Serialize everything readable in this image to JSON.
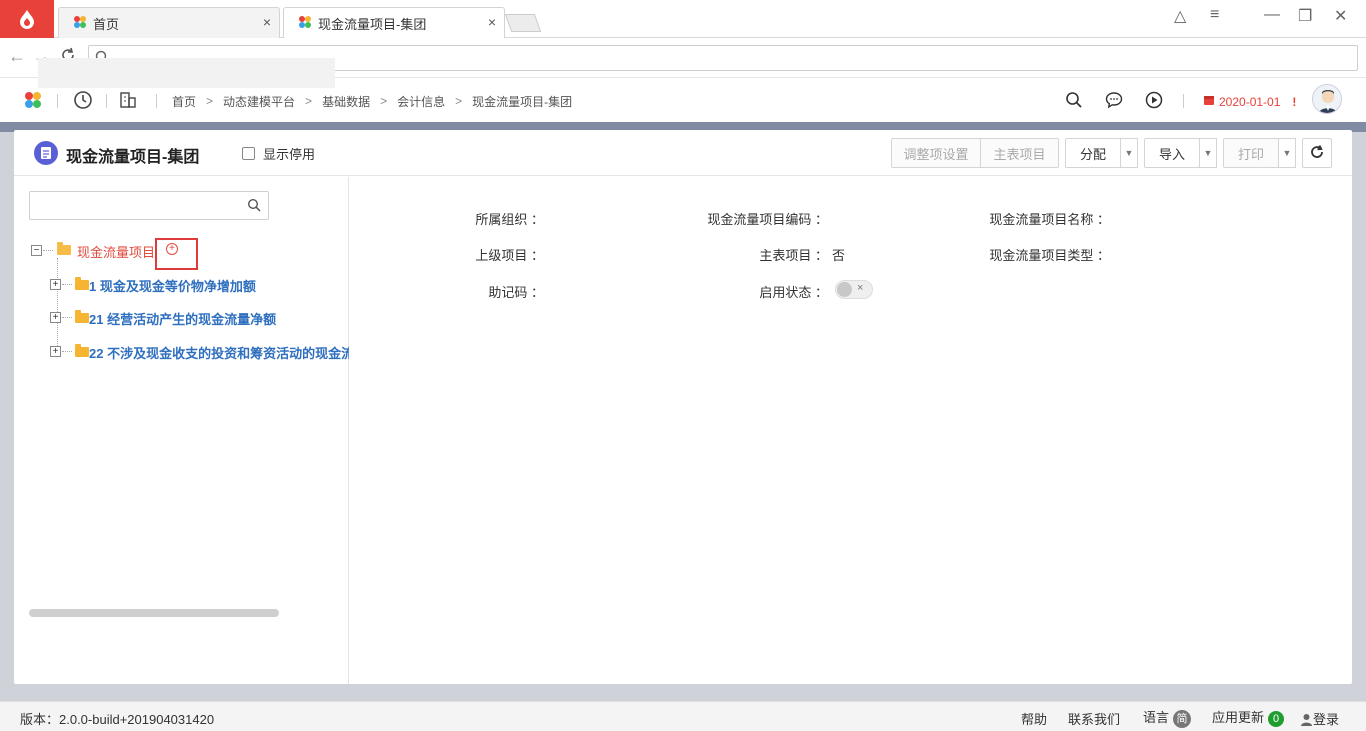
{
  "browser": {
    "tabs": [
      {
        "label": "首页"
      },
      {
        "label": "现金流量项目-集团"
      }
    ],
    "close_glyph": "×",
    "window_controls": [
      "△",
      "≡",
      "—",
      "❐",
      "✕"
    ]
  },
  "header": {
    "breadcrumb": [
      "首页",
      "动态建模平台",
      "基础数据",
      "会计信息",
      "现金流量项目-集团"
    ],
    "breadcrumb_sep": ">",
    "date": "2020-01-01",
    "date_alert": "!"
  },
  "page": {
    "title": "现金流量项目-集团",
    "show_disabled_label": "显示停用",
    "buttons": {
      "adjust": "调整项设置",
      "main_table": "主表项目",
      "assign": "分配",
      "import": "导入",
      "print": "打印"
    }
  },
  "tree": {
    "search_placeholder": "",
    "root_label": "现金流量项目",
    "add_glyph": "+",
    "items": [
      {
        "label": "1  现金及现金等价物净增加额"
      },
      {
        "label": "21  经营活动产生的现金流量净额"
      },
      {
        "label": "22  不涉及现金收支的投资和筹资活动的现金流"
      }
    ],
    "expand_glyph": "+",
    "collapse_glyph": "−"
  },
  "form": {
    "org_label": "所属组织 ：",
    "code_label": "现金流量项目编码 ：",
    "name_label": "现金流量项目名称 ：",
    "parent_label": "上级项目 ：",
    "main_label": "主表项目 ：",
    "main_value": "否",
    "type_label": "现金流量项目类型 ：",
    "mnemonic_label": "助记码 ：",
    "status_label": "启用状态 ：",
    "toggle_off_glyph": "×"
  },
  "footer": {
    "version": "版本：2.0.0-build+201904031420",
    "help": "帮助",
    "contact": "联系我们",
    "language": "语言",
    "language_badge": "简",
    "updates": "应用更新",
    "updates_count": "0",
    "login": "登录"
  },
  "colors": {
    "accent_red": "#e7413a",
    "tree_blue": "#2f6fbf",
    "badge_green": "#1f9d2f"
  },
  "icons": [
    "browser-logo-icon",
    "app-logo-icon",
    "history-icon",
    "org-icon",
    "search-icon",
    "chat-icon",
    "play-icon",
    "calendar-icon",
    "refresh-icon",
    "folder-icon",
    "user-icon"
  ]
}
